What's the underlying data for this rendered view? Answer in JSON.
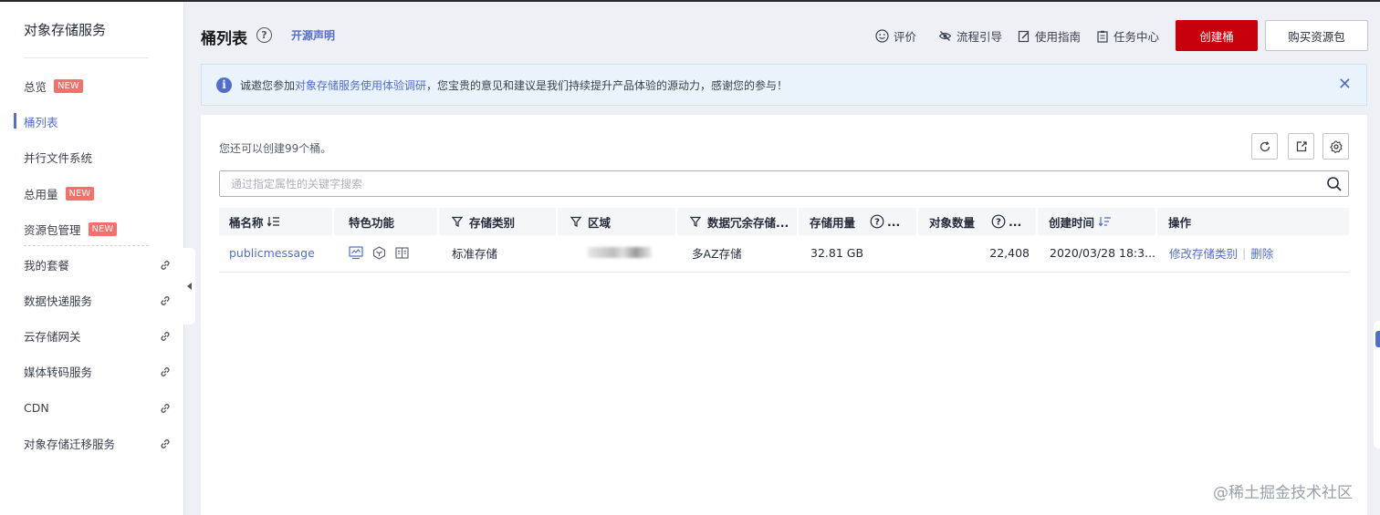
{
  "sidebar": {
    "title": "对象存储服务",
    "items": [
      {
        "label": "总览",
        "badge": "NEW"
      },
      {
        "label": "桶列表",
        "badge": ""
      },
      {
        "label": "并行文件系统",
        "badge": ""
      },
      {
        "label": "总用量",
        "badge": "NEW"
      },
      {
        "label": "资源包管理",
        "badge": "NEW"
      },
      {
        "label": "我的套餐",
        "badge": ""
      },
      {
        "label": "数据快递服务",
        "badge": ""
      },
      {
        "label": "云存储网关",
        "badge": ""
      },
      {
        "label": "媒体转码服务",
        "badge": ""
      },
      {
        "label": "CDN",
        "badge": ""
      },
      {
        "label": "对象存储迁移服务",
        "badge": ""
      }
    ]
  },
  "header": {
    "title": "桶列表",
    "open_source": "开源声明",
    "links": [
      "评价",
      "流程引导",
      "使用指南",
      "任务中心"
    ],
    "create_button": "创建桶",
    "buy_button": "购买资源包"
  },
  "notice": {
    "prefix": "诚邀您参加",
    "link": "对象存储服务使用体验调研",
    "suffix": "，您宝贵的意见和建议是我们持续提升产品体验的源动力，感谢您的参与！"
  },
  "panel": {
    "quota": "您还可以创建99个桶。",
    "search_placeholder": "通过指定属性的关键字搜索"
  },
  "table": {
    "columns": [
      "桶名称",
      "特色功能",
      "存储类别",
      "区域",
      "数据冗余存储...",
      "存储用量",
      "...",
      "对象数量",
      "...",
      "创建时间",
      "操作"
    ],
    "rows": [
      {
        "name": "publicmessage",
        "storage_class": "标准存储",
        "redundancy": "多AZ存储",
        "usage": "32.81 GB",
        "objects": "22,408",
        "created": "2020/03/28 18:3...",
        "action_modify": "修改存储类别",
        "action_sep": "|",
        "action_delete": "删除"
      }
    ]
  },
  "watermark": "@稀土掘金技术社区",
  "colors": {
    "accent": "#526ecc",
    "brand_red": "#c7000b",
    "badge": "#f66f6a"
  }
}
